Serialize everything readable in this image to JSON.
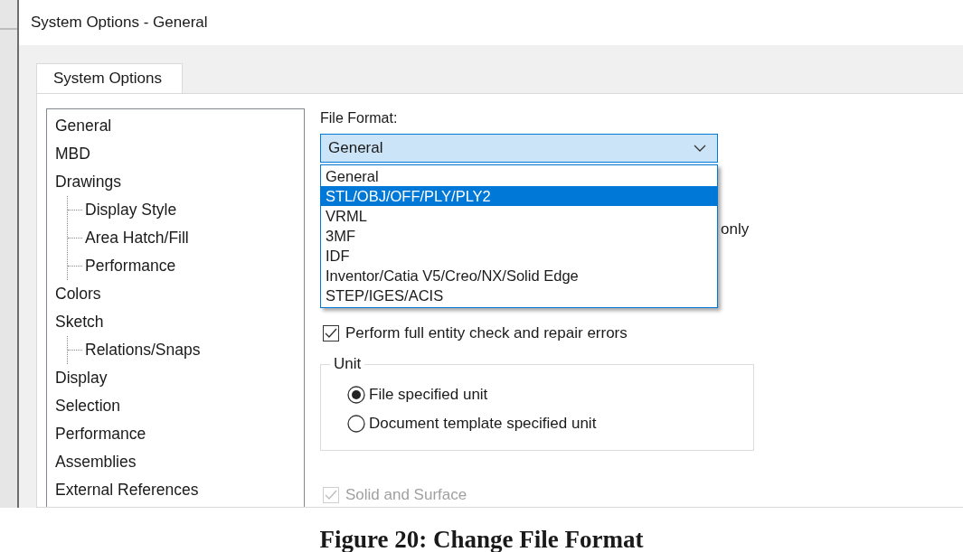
{
  "window": {
    "title": "System Options - General"
  },
  "tabs": [
    {
      "label": "System Options",
      "selected": true
    }
  ],
  "sidebar": {
    "items": [
      {
        "label": "General"
      },
      {
        "label": "MBD"
      },
      {
        "label": "Drawings",
        "children": [
          {
            "label": "Display Style"
          },
          {
            "label": "Area Hatch/Fill"
          },
          {
            "label": "Performance"
          }
        ]
      },
      {
        "label": "Colors"
      },
      {
        "label": "Sketch",
        "children": [
          {
            "label": "Relations/Snaps"
          }
        ]
      },
      {
        "label": "Display"
      },
      {
        "label": "Selection"
      },
      {
        "label": "Performance"
      },
      {
        "label": "Assemblies"
      },
      {
        "label": "External References"
      }
    ]
  },
  "file_format": {
    "label": "File Format:",
    "value": "General",
    "expanded": true,
    "options": [
      {
        "label": "General",
        "highlighted": false
      },
      {
        "label": "STL/OBJ/OFF/PLY/PLY2",
        "highlighted": true
      },
      {
        "label": "VRML",
        "highlighted": false
      },
      {
        "label": "3MF",
        "highlighted": false
      },
      {
        "label": "IDF",
        "highlighted": false
      },
      {
        "label": "Inventor/Catia V5/Creo/NX/Solid Edge",
        "highlighted": false
      },
      {
        "label": "STEP/IGES/ACIS",
        "highlighted": false
      }
    ]
  },
  "partly_hidden_text": "only",
  "options": [
    {
      "label": "Perform full entity check and repair errors",
      "checked": true,
      "disabled": false
    }
  ],
  "unit": {
    "title": "Unit",
    "options": [
      {
        "label": "File specified unit",
        "selected": true
      },
      {
        "label": "Document template specified unit",
        "selected": false
      }
    ]
  },
  "lower_options": [
    {
      "label": "Solid and Surface",
      "checked": true,
      "disabled": true
    }
  ],
  "caption": "Figure 20: Change File Format"
}
